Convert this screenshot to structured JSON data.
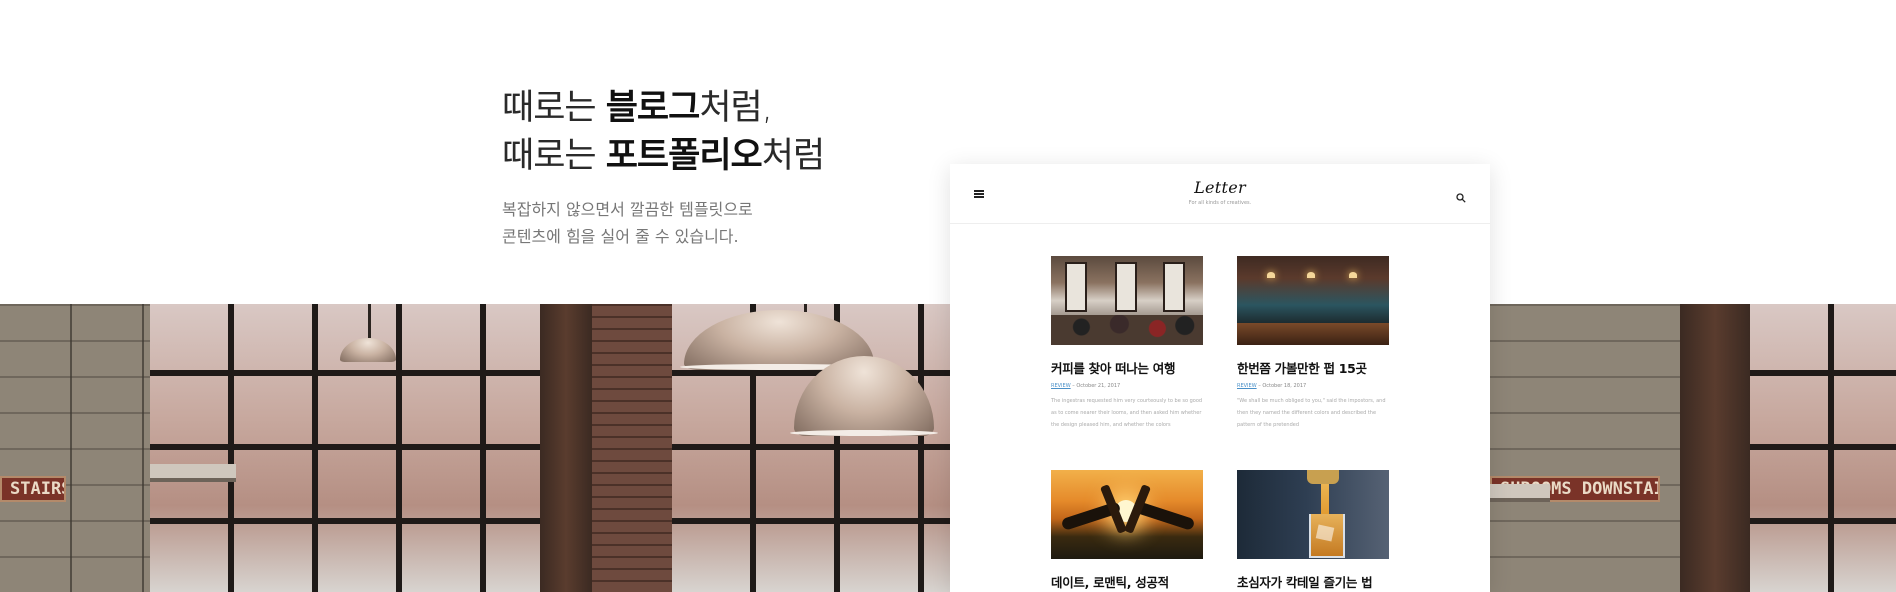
{
  "hero": {
    "line1": {
      "pre": "때로는 ",
      "bold": "블로그",
      "post": "처럼,"
    },
    "line2": {
      "pre": "때로는 ",
      "bold": "포트폴리오",
      "post": "처럼"
    },
    "sub1": "복잡하지 않으면서 깔끔한 템플릿으로",
    "sub2": "콘텐츠에 힘을 실어 줄 수 있습니다."
  },
  "background_photo": {
    "sign_left": "STAIRS",
    "sign_right": "SHROOMS DOWNSTAIRS"
  },
  "mockup": {
    "logo": "Letter",
    "tagline": "For all kinds of creatives.",
    "menu_icon": "hamburger-menu-icon",
    "search_icon": "search-icon",
    "posts": [
      {
        "title": "커피를 찾아 떠나는 여행",
        "category": "REVIEW",
        "date": "October 21, 2017",
        "excerpt": "The ingestras requested him very courteously to be so good as to come nearer their looms, and then asked him whether the design pleased him, and whether the colors"
      },
      {
        "title": "한번쯤 가볼만한 펍 15곳",
        "category": "REVIEW",
        "date": "October 18, 2017",
        "excerpt": "\"We shall be much obliged to you,\" said the impostors, and then they named the different colors and described the pattern of the pretended"
      },
      {
        "title": "데이트, 로맨틱, 성공적",
        "category": "",
        "date": "",
        "excerpt": ""
      },
      {
        "title": "초심자가 칵테일 즐기는 법",
        "category": "",
        "date": "",
        "excerpt": ""
      }
    ],
    "meta_separator": " – "
  }
}
